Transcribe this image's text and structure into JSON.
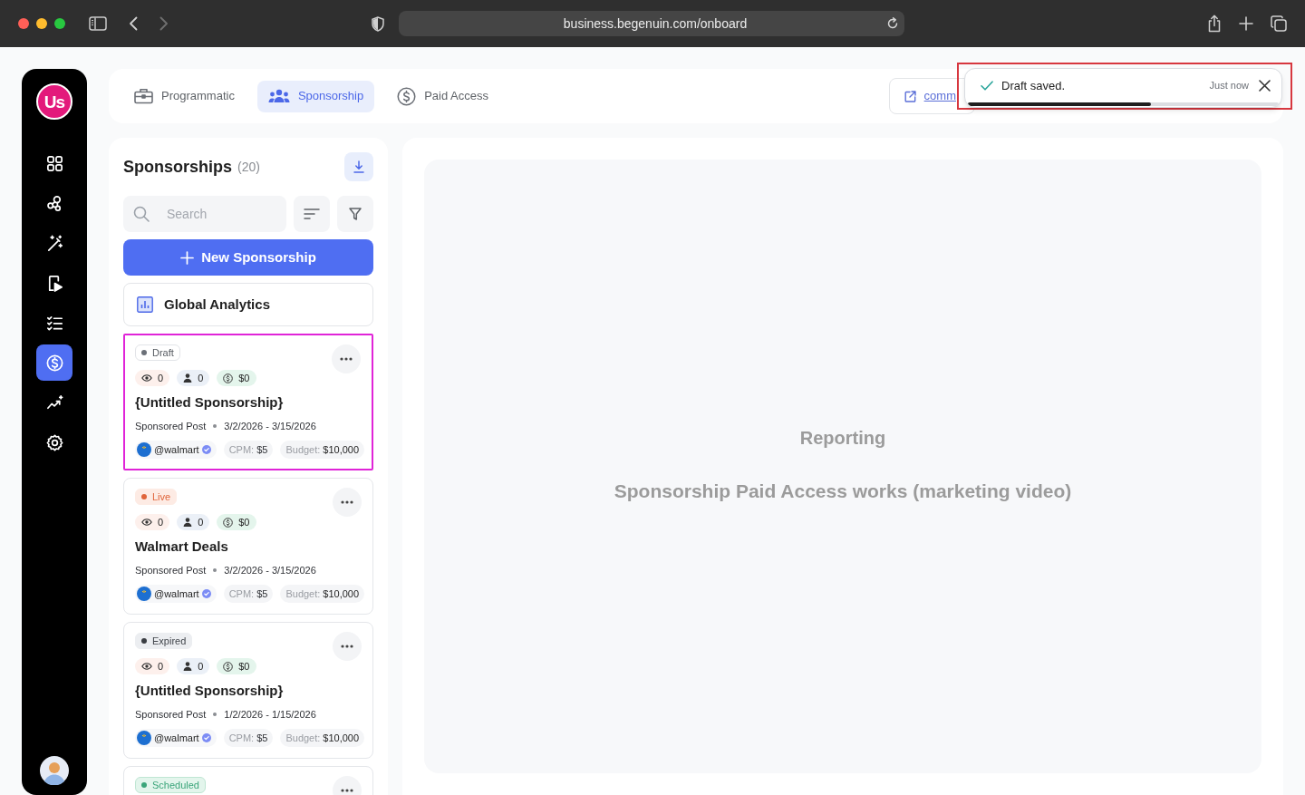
{
  "browser": {
    "url": "business.begenuin.com/onboard",
    "forward_disabled": true
  },
  "sidebar": {
    "logo_text": "Us",
    "items": [
      {
        "selected": false
      },
      {
        "selected": false
      },
      {
        "selected": false
      },
      {
        "selected": false
      },
      {
        "selected": false
      },
      {
        "selected": true
      },
      {
        "selected": false
      },
      {
        "selected": false
      }
    ]
  },
  "tabs": [
    {
      "label": "Programmatic",
      "selected": false
    },
    {
      "label": "Sponsorship",
      "selected": true
    },
    {
      "label": "Paid Access",
      "selected": false
    }
  ],
  "link": {
    "label": "comm"
  },
  "toast": {
    "message": "Draft saved.",
    "time": "Just now",
    "level": 0.59,
    "outlined": true
  },
  "list": {
    "title": "Sponsorships",
    "count": "(20)",
    "search": {
      "placeholder": "Search"
    },
    "new_button": "New Sponsorship",
    "analytics_button": "Global Analytics",
    "cards": [
      {
        "selected": true,
        "status": {
          "label": "Draft",
          "kind": "draft"
        },
        "stats": {
          "views": "0",
          "audience": "0",
          "earnings": "$0"
        },
        "title": "{Untitled Sponsorship}",
        "type": "Sponsored Post",
        "dates": "3/2/2026 - 3/15/2026",
        "handle": "@walmart",
        "verified": true,
        "cpm": {
          "label": "CPM:",
          "value": "$5"
        },
        "budget": {
          "label": "Budget:",
          "value": "$10,000"
        }
      },
      {
        "selected": false,
        "status": {
          "label": "Live",
          "kind": "live"
        },
        "stats": {
          "views": "0",
          "audience": "0",
          "earnings": "$0"
        },
        "title": "Walmart Deals",
        "type": "Sponsored Post",
        "dates": "3/2/2026 - 3/15/2026",
        "handle": "@walmart",
        "verified": true,
        "cpm": {
          "label": "CPM:",
          "value": "$5"
        },
        "budget": {
          "label": "Budget:",
          "value": "$10,000"
        }
      },
      {
        "selected": false,
        "status": {
          "label": "Expired",
          "kind": "expired"
        },
        "stats": {
          "views": "0",
          "audience": "0",
          "earnings": "$0"
        },
        "title": "{Untitled Sponsorship}",
        "type": "Sponsored Post",
        "dates": "1/2/2026 - 1/15/2026",
        "handle": "@walmart",
        "verified": true,
        "cpm": {
          "label": "CPM:",
          "value": "$5"
        },
        "budget": {
          "label": "Budget:",
          "value": "$10,000"
        }
      },
      {
        "selected": false,
        "status": {
          "label": "Scheduled",
          "kind": "scheduled"
        }
      }
    ]
  },
  "report": {
    "title": "Reporting",
    "subtitle": "Sponsorship Paid Access works (marketing video)"
  }
}
